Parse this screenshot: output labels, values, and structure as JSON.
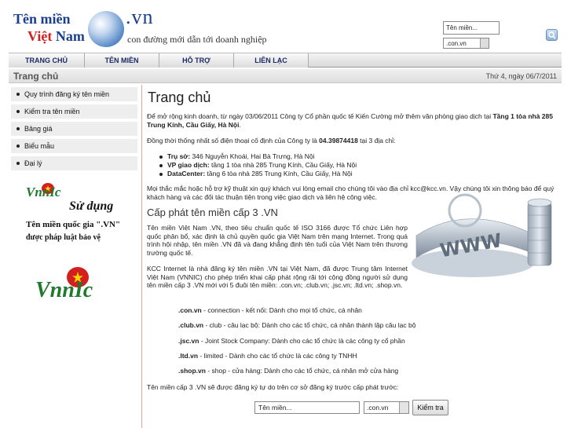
{
  "header": {
    "logo_line1": "Tên miền",
    "logo_line2a": "Việt",
    "logo_line2b": "Nam",
    "logo_vn": ".vn",
    "slogan": "con đường mới dẫn tới doanh nghiệp",
    "domain_placeholder": "Tên miền...",
    "ext_selected": ".con.vn"
  },
  "nav": {
    "items": [
      {
        "label": "TRANG CHỦ"
      },
      {
        "label": "TÊN MIỀN"
      },
      {
        "label": "HỖ TRỢ"
      },
      {
        "label": "LIÊN LẠC"
      }
    ]
  },
  "titlebar": {
    "title": "Trang chủ",
    "date": "Thứ 4, ngày 06/7/2011"
  },
  "sidebar": {
    "items": [
      {
        "label": "Quy trình đăng ký tên miền"
      },
      {
        "label": "Kiểm tra tên miền"
      },
      {
        "label": "Bảng giá"
      },
      {
        "label": "Biểu mẫu"
      },
      {
        "label": "Đại lý"
      }
    ],
    "ad1": {
      "mark": "VnnIc",
      "line1": "Sử dụng",
      "line2": "Tên miền quốc gia \".VN\"",
      "line3": "được pháp luật bảo vệ"
    },
    "ad2": {
      "mark": "VnnIc"
    }
  },
  "main": {
    "title": "Trang chủ",
    "p1_a": "Để mở rộng kinh doanh, từ ngày 03/06/2011 Công ty Cổ phần quốc tế Kiến Cường mở thêm văn phòng giao dịch tại ",
    "p1_b": "Tầng 1 tòa nhà 285 Trung Kính, Cầu Giấy, Hà Nội",
    "p1_c": ".",
    "p2_a": "Đồng thời thống nhất số điện thoại cố định của Công ty là ",
    "p2_b": "04.39874418",
    "p2_c": " tại 3 địa chỉ:",
    "addresses": [
      {
        "label": "Trụ sở:",
        "text": " 346 Nguyễn Khoái, Hai Bà Trưng, Hà Nội"
      },
      {
        "label": "VP giao dịch:",
        "text": " tầng 1 tòa nhà 285 Trung Kính, Cầu Giấy, Hà Nội"
      },
      {
        "label": "DataCenter:",
        "text": " tầng 6 tòa nhà 285 Trung Kính, Cầu Giấy, Hà Nội"
      }
    ],
    "p3": "Mọi thắc mắc hoặc hỗ trợ kỹ thuật xin quý khách vui lòng email cho chúng tôi vào địa chỉ kcc@kcc.vn. Vậy chúng tôi xin thông báo để quý khách hàng và các đối tác thuận tiện trong việc giao dịch và liên hệ công việc.",
    "h2": "Cấp phát tên miền cấp 3 .VN",
    "intro1": "Tên miền Việt Nam .VN, theo tiêu chuẩn quốc tế ISO 3166 được Tổ chức Liên hợp quốc phân bổ, xác định là chủ quyền quốc gia Việt Nam trên mạng Internet. Trong quá trình hội nhập, tên miền .VN đã và đang khẳng định tên tuổi của Việt Nam trên thương trường quốc tế.",
    "intro2": "KCC Internet là nhà đăng ký tên miền .VN tại Việt Nam, đã được Trung tâm Internet Việt Nam (VNNIC) cho phép triển khai cấp phát rộng rãi tới cộng đồng người sử dụng tên miền cấp 3 .VN mới với 5 đuôi tên miền: .con.vn; .club.vn; .jsc.vn; .ltd.vn; .shop.vn.",
    "extensions": [
      {
        "ext": ".con.vn",
        "desc": " - connection - kết nối: Dành cho mọi tổ chức, cá nhân"
      },
      {
        "ext": ".club.vn",
        "desc": " - club - câu lạc bộ: Dành cho các tổ chức, cá nhân thành lập câu lạc bộ"
      },
      {
        "ext": ".jsc.vn",
        "desc": " - Joint Stock Company: Dành cho các tổ chức là các công ty cổ phần"
      },
      {
        "ext": ".ltd.vn",
        "desc": " - limited - Dành cho các tổ chức là các công ty TNHH"
      },
      {
        "ext": ".shop.vn",
        "desc": " - shop - cửa hàng: Dành cho các tổ chức, cá nhân mở cửa hàng"
      }
    ],
    "closing": "Tên miền cấp 3 .VN sẽ được đăng ký tự do trên cơ sở đăng ký trước cấp phát trước:",
    "form_placeholder": "Tên miền...",
    "form_ext": ".con.vn",
    "form_button": "Kiểm tra"
  }
}
